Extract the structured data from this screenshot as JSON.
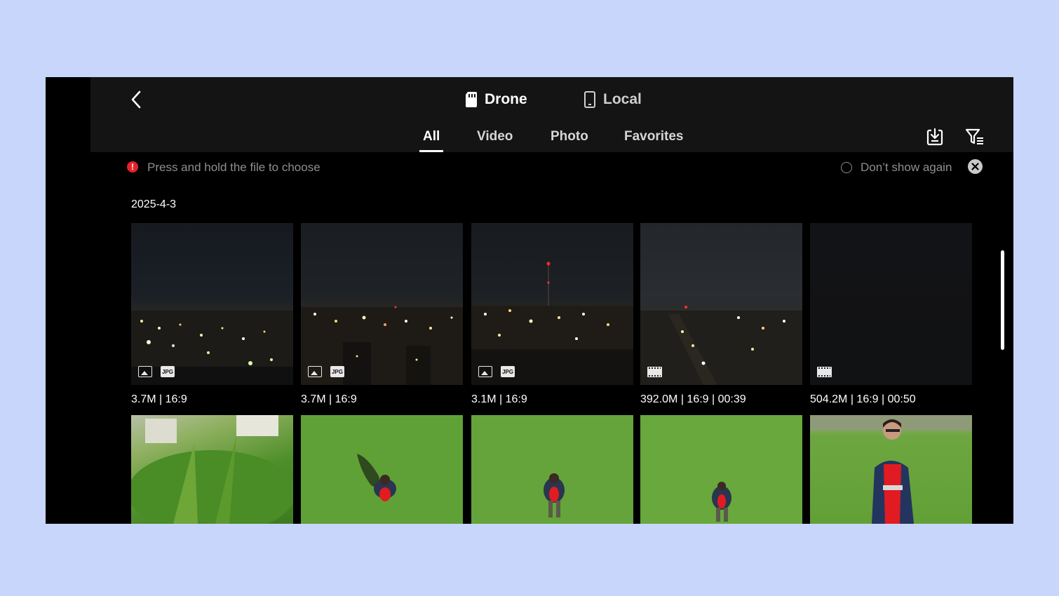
{
  "header": {
    "sources": [
      {
        "label": "Drone",
        "icon": "sd-card-icon",
        "active": true
      },
      {
        "label": "Local",
        "icon": "phone-icon",
        "active": false
      }
    ],
    "tabs": [
      {
        "label": "All",
        "active": true
      },
      {
        "label": "Video",
        "active": false
      },
      {
        "label": "Photo",
        "active": false
      },
      {
        "label": "Favorites",
        "active": false
      }
    ],
    "actions": [
      "download-icon",
      "filter-icon"
    ]
  },
  "hint": {
    "text": "Press and hold the file to choose",
    "dont_show": "Don’t show again"
  },
  "groups": [
    {
      "date": "2025-4-3",
      "items": [
        {
          "type": "photo",
          "meta": "3.7M | 16:9",
          "badge": "JPG"
        },
        {
          "type": "photo",
          "meta": "3.7M | 16:9",
          "badge": "JPG"
        },
        {
          "type": "photo",
          "meta": "3.1M | 16:9",
          "badge": "JPG"
        },
        {
          "type": "video",
          "meta": "392.0M | 16:9 | 00:39"
        },
        {
          "type": "video",
          "meta": "504.2M | 16:9 | 00:50"
        },
        {
          "type": "photo",
          "meta": ""
        },
        {
          "type": "photo",
          "meta": ""
        },
        {
          "type": "photo",
          "meta": ""
        },
        {
          "type": "photo",
          "meta": ""
        },
        {
          "type": "photo",
          "meta": ""
        }
      ]
    }
  ],
  "colors": {
    "background": "#c9d6fb",
    "screen": "#000000",
    "header": "#141414",
    "alert": "#e5232b"
  }
}
